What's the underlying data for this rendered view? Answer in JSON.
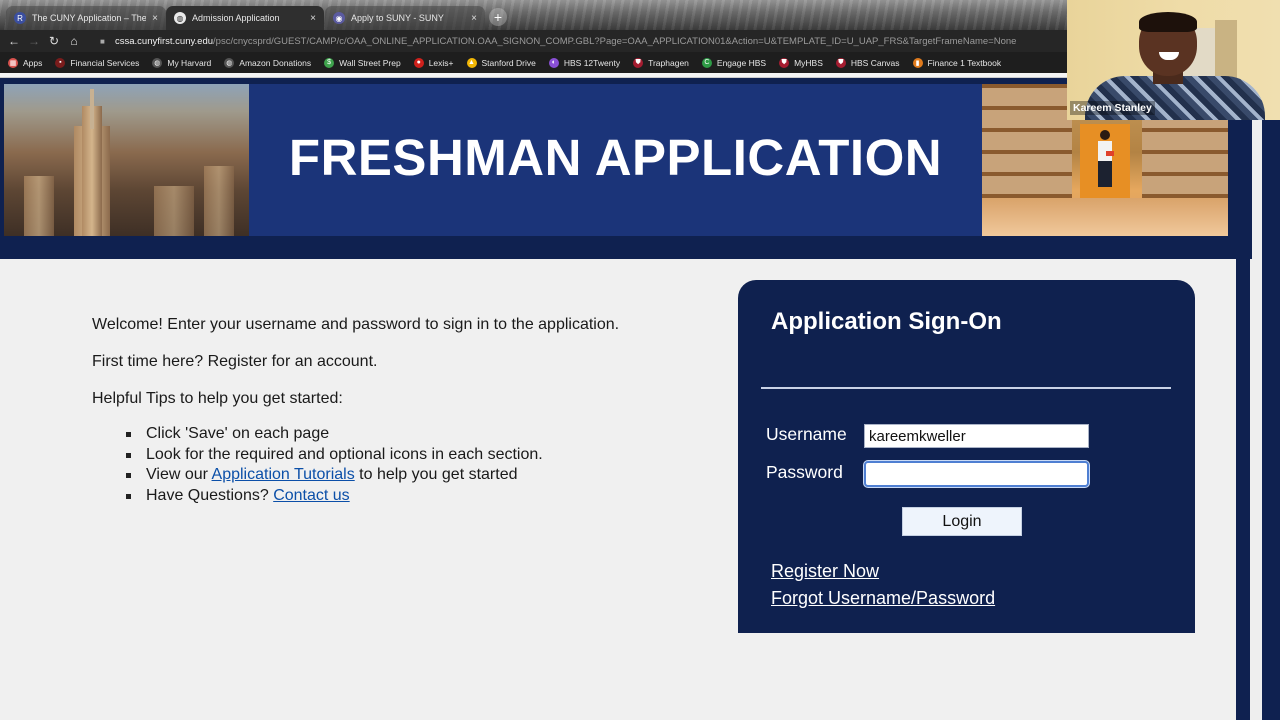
{
  "browser": {
    "tabs": [
      {
        "title": "The CUNY Application – The C",
        "icon": "cuny-logo-icon",
        "active": false
      },
      {
        "title": "Admission Application",
        "icon": "globe-icon",
        "active": true
      },
      {
        "title": "Apply to SUNY - SUNY",
        "icon": "suny-logo-icon",
        "active": false
      }
    ],
    "new_tab": "+",
    "close_glyph": "×",
    "nav": {
      "back": "←",
      "forward": "→",
      "reload": "↻",
      "home": "⌂"
    },
    "url_host": "cssa.cunyfirst.cuny.edu",
    "url_path": "/psc/cnycsprd/GUEST/CAMP/c/OAA_ONLINE_APPLICATION.OAA_SIGNON_COMP.GBL?Page=OAA_APPLICATION01&Action=U&TEMPLATE_ID=U_UAP_FRS&TargetFrameName=None",
    "bookmarks": [
      {
        "label": "Apps",
        "icon": "apps-grid-icon",
        "color": "#d9534f"
      },
      {
        "label": "Financial Services",
        "icon": "bank-icon",
        "color": "#7a1c1c"
      },
      {
        "label": "My Harvard",
        "icon": "globe-icon",
        "color": "#555555"
      },
      {
        "label": "Amazon Donations",
        "icon": "globe-icon",
        "color": "#555555"
      },
      {
        "label": "Wall Street Prep",
        "icon": "wsp-icon",
        "color": "#3fa34d"
      },
      {
        "label": "Lexis+",
        "icon": "lexis-icon",
        "color": "#d0211c"
      },
      {
        "label": "Stanford Drive",
        "icon": "google-drive-icon",
        "color": "#f2b705"
      },
      {
        "label": "HBS 12Twenty",
        "icon": "12twenty-icon",
        "color": "#8a4fd6"
      },
      {
        "label": "Traphagen",
        "icon": "harvard-shield-icon",
        "color": "#a51c30"
      },
      {
        "label": "Engage HBS",
        "icon": "engage-icon",
        "color": "#2e9b46"
      },
      {
        "label": "MyHBS",
        "icon": "harvard-shield-icon",
        "color": "#a51c30"
      },
      {
        "label": "HBS Canvas",
        "icon": "harvard-shield-icon",
        "color": "#a51c30"
      },
      {
        "label": "Finance 1 Textbook",
        "icon": "book-icon",
        "color": "#e07b1d"
      }
    ]
  },
  "banner": {
    "title": "FRESHMAN APPLICATION"
  },
  "intro": {
    "welcome": "Welcome! Enter your username and password to sign in to the application.",
    "first_time": "First time here? Register for an account.",
    "tips_heading": "Helpful Tips to help you get started:",
    "tips": [
      {
        "text": "Click 'Save' on each page"
      },
      {
        "text": "Look for the required and optional icons in each section."
      },
      {
        "pre": "View our ",
        "link": "Application Tutorials",
        "post": " to help you get started"
      },
      {
        "pre": "Have Questions? ",
        "link": "Contact us",
        "post": ""
      }
    ]
  },
  "signon": {
    "title": "Application Sign-On",
    "username_label": "Username",
    "username_value": "kareemkweller",
    "password_label": "Password",
    "password_value": "",
    "login_label": "Login",
    "register_link": "Register Now",
    "forgot_link": "Forgot Username/Password"
  },
  "webcam": {
    "participant_name": "Kareem Stanley"
  },
  "colors": {
    "navy": "#0f214f",
    "banner_blue": "#1b3479",
    "link_blue": "#0b4fa8",
    "page_bg": "#f0f0f0"
  }
}
